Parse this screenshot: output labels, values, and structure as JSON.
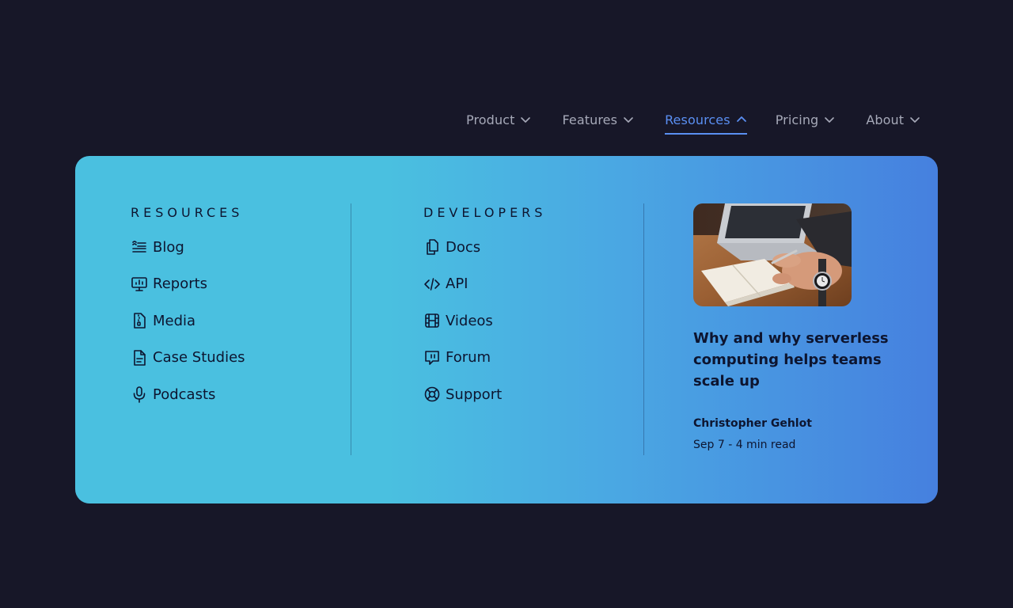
{
  "nav": {
    "items": [
      {
        "label": "Product",
        "state": "collapsed"
      },
      {
        "label": "Features",
        "state": "collapsed"
      },
      {
        "label": "Resources",
        "state": "expanded"
      },
      {
        "label": "Pricing",
        "state": "collapsed"
      },
      {
        "label": "About",
        "state": "collapsed"
      }
    ],
    "active_color": "#5a8ff2",
    "inactive_color": "#a6a9b8"
  },
  "menu": {
    "resources": {
      "heading": "RESOURCES",
      "links": [
        {
          "label": "Blog",
          "icon": "blog-icon"
        },
        {
          "label": "Reports",
          "icon": "presentation-chart-icon"
        },
        {
          "label": "Media",
          "icon": "zip-file-icon"
        },
        {
          "label": "Case Studies",
          "icon": "document-icon"
        },
        {
          "label": "Podcasts",
          "icon": "microphone-icon"
        }
      ]
    },
    "developers": {
      "heading": "DEVELOPERS",
      "links": [
        {
          "label": "Docs",
          "icon": "copy-documents-icon"
        },
        {
          "label": "API",
          "icon": "code-icon"
        },
        {
          "label": "Videos",
          "icon": "film-icon"
        },
        {
          "label": "Forum",
          "icon": "chat-bubble-icon"
        },
        {
          "label": "Support",
          "icon": "lifebuoy-icon"
        }
      ]
    },
    "featured": {
      "image": "laptop-notebook-photo",
      "title": "Why and why serverless computing helps teams scale up",
      "author": "Christopher Gehlot",
      "meta": "Sep 7 - 4 min read"
    },
    "panel_gradient": [
      "#4ac0e0",
      "#4aa8e3",
      "#4680df"
    ]
  },
  "background_color": "#171728"
}
